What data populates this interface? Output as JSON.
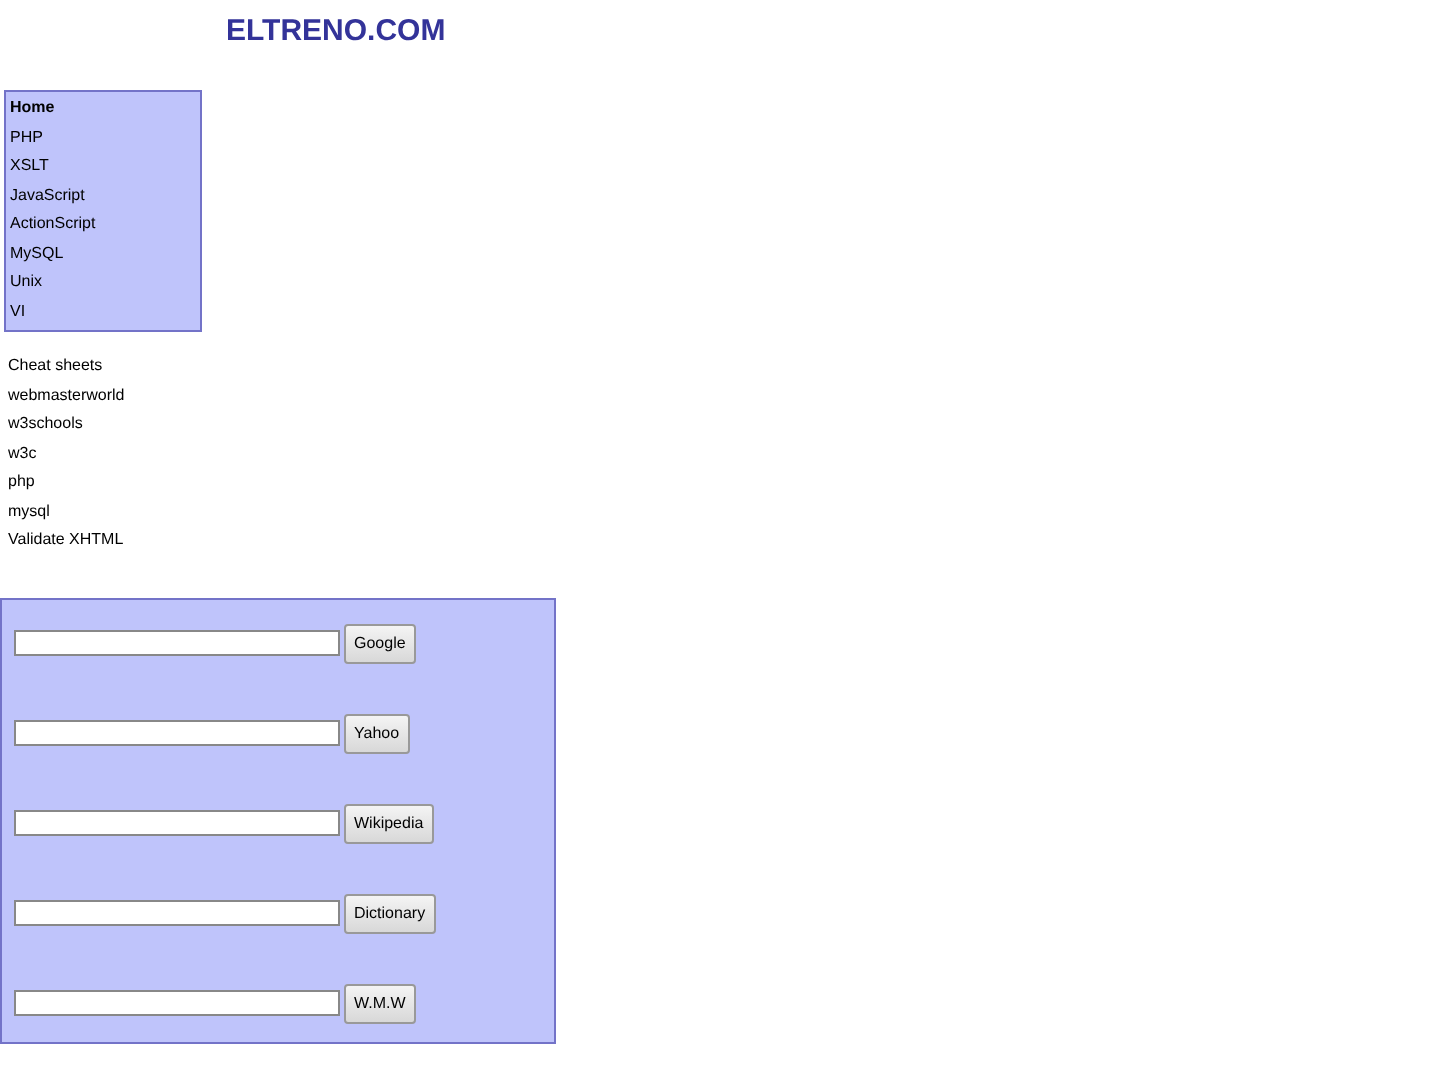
{
  "site_title": "ELTRENO.COM",
  "nav": [
    {
      "label": "Home",
      "selected": true
    },
    {
      "label": "PHP",
      "selected": false
    },
    {
      "label": "XSLT",
      "selected": false
    },
    {
      "label": "JavaScript",
      "selected": false
    },
    {
      "label": "ActionScript",
      "selected": false
    },
    {
      "label": "MySQL",
      "selected": false
    },
    {
      "label": "Unix",
      "selected": false
    },
    {
      "label": "VI",
      "selected": false
    }
  ],
  "links": [
    "Cheat sheets",
    "webmasterworld",
    "w3schools",
    "w3c",
    "php",
    "mysql",
    "Validate XHTML"
  ],
  "searches": [
    {
      "button": "Google"
    },
    {
      "button": "Yahoo"
    },
    {
      "button": "Wikipedia"
    },
    {
      "button": "Dictionary"
    },
    {
      "button": "W.M.W"
    }
  ]
}
